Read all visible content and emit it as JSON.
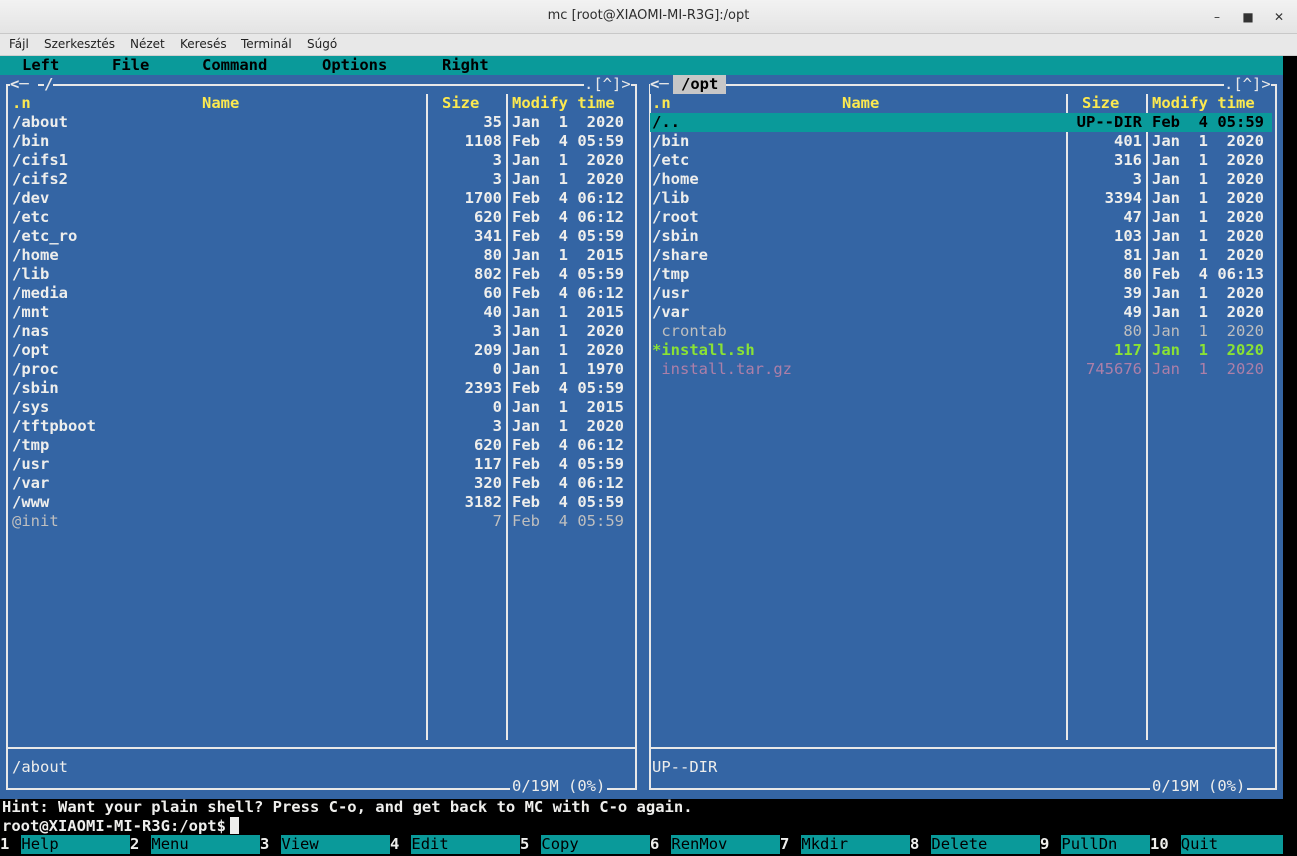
{
  "window": {
    "title": "mc [root@XIAOMI-MI-R3G]:/opt",
    "minimize": "–",
    "maximize": "■",
    "close": "✕"
  },
  "terminal_menu": [
    "Fájl",
    "Szerkesztés",
    "Nézet",
    "Keresés",
    "Terminál",
    "Súgó"
  ],
  "mc_menu": [
    "Left",
    "File",
    "Command",
    "Options",
    "Right"
  ],
  "left_panel": {
    "path": "/",
    "corner": ".[^]>",
    "headers": {
      "n": ".n",
      "name": "Name",
      "size": "Size",
      "modify": "Modify time"
    },
    "rows": [
      {
        "name": "/about",
        "size": "35",
        "date": "Jan  1  2020",
        "style": "dir"
      },
      {
        "name": "/bin",
        "size": "1108",
        "date": "Feb  4 05:59",
        "style": "dir"
      },
      {
        "name": "/cifs1",
        "size": "3",
        "date": "Jan  1  2020",
        "style": "dir"
      },
      {
        "name": "/cifs2",
        "size": "3",
        "date": "Jan  1  2020",
        "style": "dir"
      },
      {
        "name": "/dev",
        "size": "1700",
        "date": "Feb  4 06:12",
        "style": "dir"
      },
      {
        "name": "/etc",
        "size": "620",
        "date": "Feb  4 06:12",
        "style": "dir"
      },
      {
        "name": "/etc_ro",
        "size": "341",
        "date": "Feb  4 05:59",
        "style": "dir"
      },
      {
        "name": "/home",
        "size": "80",
        "date": "Jan  1  2015",
        "style": "dir"
      },
      {
        "name": "/lib",
        "size": "802",
        "date": "Feb  4 05:59",
        "style": "dir"
      },
      {
        "name": "/media",
        "size": "60",
        "date": "Feb  4 06:12",
        "style": "dir"
      },
      {
        "name": "/mnt",
        "size": "40",
        "date": "Jan  1  2015",
        "style": "dir"
      },
      {
        "name": "/nas",
        "size": "3",
        "date": "Jan  1  2020",
        "style": "dir"
      },
      {
        "name": "/opt",
        "size": "209",
        "date": "Jan  1  2020",
        "style": "dir"
      },
      {
        "name": "/proc",
        "size": "0",
        "date": "Jan  1  1970",
        "style": "dir"
      },
      {
        "name": "/sbin",
        "size": "2393",
        "date": "Feb  4 05:59",
        "style": "dir"
      },
      {
        "name": "/sys",
        "size": "0",
        "date": "Jan  1  2015",
        "style": "dir"
      },
      {
        "name": "/tftpboot",
        "size": "3",
        "date": "Jan  1  2020",
        "style": "dir"
      },
      {
        "name": "/tmp",
        "size": "620",
        "date": "Feb  4 06:12",
        "style": "dir"
      },
      {
        "name": "/usr",
        "size": "117",
        "date": "Feb  4 05:59",
        "style": "dir"
      },
      {
        "name": "/var",
        "size": "320",
        "date": "Feb  4 06:12",
        "style": "dir"
      },
      {
        "name": "/www",
        "size": "3182",
        "date": "Feb  4 05:59",
        "style": "dir"
      },
      {
        "name": "@init",
        "size": "7",
        "date": "Feb  4 05:59",
        "style": "dim"
      }
    ],
    "mini_status": "/about",
    "free": "0/19M (0%)"
  },
  "right_panel": {
    "path": "/opt",
    "corner": ".[^]>",
    "headers": {
      "n": ".n",
      "name": "Name",
      "size": "Size",
      "modify": "Modify time"
    },
    "rows": [
      {
        "name": "/..",
        "size": "UP--DIR",
        "date": "Feb  4 05:59",
        "style": "sel"
      },
      {
        "name": "/bin",
        "size": "401",
        "date": "Jan  1  2020",
        "style": "dir"
      },
      {
        "name": "/etc",
        "size": "316",
        "date": "Jan  1  2020",
        "style": "dir"
      },
      {
        "name": "/home",
        "size": "3",
        "date": "Jan  1  2020",
        "style": "dir"
      },
      {
        "name": "/lib",
        "size": "3394",
        "date": "Jan  1  2020",
        "style": "dir"
      },
      {
        "name": "/root",
        "size": "47",
        "date": "Jan  1  2020",
        "style": "dir"
      },
      {
        "name": "/sbin",
        "size": "103",
        "date": "Jan  1  2020",
        "style": "dir"
      },
      {
        "name": "/share",
        "size": "81",
        "date": "Jan  1  2020",
        "style": "dir"
      },
      {
        "name": "/tmp",
        "size": "80",
        "date": "Feb  4 06:13",
        "style": "dir"
      },
      {
        "name": "/usr",
        "size": "39",
        "date": "Jan  1  2020",
        "style": "dir"
      },
      {
        "name": "/var",
        "size": "49",
        "date": "Jan  1  2020",
        "style": "dir"
      },
      {
        "name": " crontab",
        "size": "80",
        "date": "Jan  1  2020",
        "style": "dim"
      },
      {
        "name": "*install.sh",
        "size": "117",
        "date": "Jan  1  2020",
        "style": "exec"
      },
      {
        "name": " install.tar.gz",
        "size": "745676",
        "date": "Jan  1  2020",
        "style": "arch"
      }
    ],
    "mini_status": "UP--DIR",
    "free": "0/19M (0%)"
  },
  "hint": "Hint: Want your plain shell? Press C-o, and get back to MC with C-o again.",
  "prompt": "root@XIAOMI-MI-R3G:/opt$",
  "fkeys": [
    {
      "num": "1",
      "label": "Help"
    },
    {
      "num": "2",
      "label": "Menu"
    },
    {
      "num": "3",
      "label": "View"
    },
    {
      "num": "4",
      "label": "Edit"
    },
    {
      "num": "5",
      "label": "Copy"
    },
    {
      "num": "6",
      "label": "RenMov"
    },
    {
      "num": "7",
      "label": "Mkdir"
    },
    {
      "num": "8",
      "label": "Delete"
    },
    {
      "num": "9",
      "label": "PullDn"
    },
    {
      "num": "10",
      "label": "Quit"
    }
  ]
}
